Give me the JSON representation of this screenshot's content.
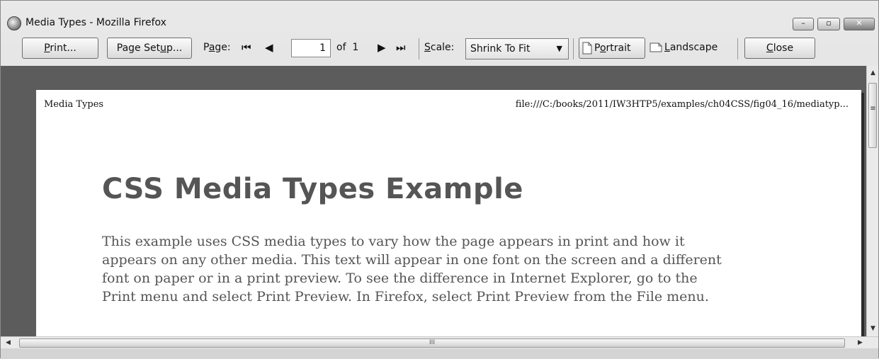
{
  "window": {
    "title": "Media Types - Mozilla Firefox",
    "controls": {
      "minimize": "–",
      "maximize": "▫",
      "close": "✕"
    }
  },
  "toolbar": {
    "print_pre": "",
    "print_ul": "P",
    "print_post": "rint...",
    "page_setup_pre": "Page Set",
    "page_setup_ul": "u",
    "page_setup_post": "p...",
    "page_label_pre": "P",
    "page_label_ul": "a",
    "page_label_post": "ge:",
    "first_icon": "⏮",
    "prev_icon": "◀",
    "page_value": "1",
    "of_text": "of  1",
    "next_icon": "▶",
    "last_icon": "⏭",
    "scale_label_ul": "S",
    "scale_label_post": "cale:",
    "scale_value": "Shrink To Fit",
    "portrait_pre": "P",
    "portrait_ul": "o",
    "portrait_post": "rtrait",
    "landscape_ul": "L",
    "landscape_post": "andscape",
    "close_ul": "C",
    "close_post": "lose"
  },
  "page": {
    "header_left": "Media Types",
    "header_right": "file:///C:/books/2011/IW3HTP5/examples/ch04CSS/fig04_16/mediatyp...",
    "heading": "CSS Media Types Example",
    "body_lines": [
      "This example uses CSS media types to vary how the page appears in print and how it",
      "appears on any other media. This text will appear in one font on the screen and a different",
      "font on paper or in a print preview. To see the difference in Internet Explorer, go to the",
      "Print menu and select Print Preview. In Firefox, select Print Preview from the File menu."
    ]
  },
  "scrollbars": {
    "up": "▲",
    "down": "▼",
    "left": "◀",
    "right": "▶",
    "grip": "III",
    "vgrip": "≡"
  }
}
